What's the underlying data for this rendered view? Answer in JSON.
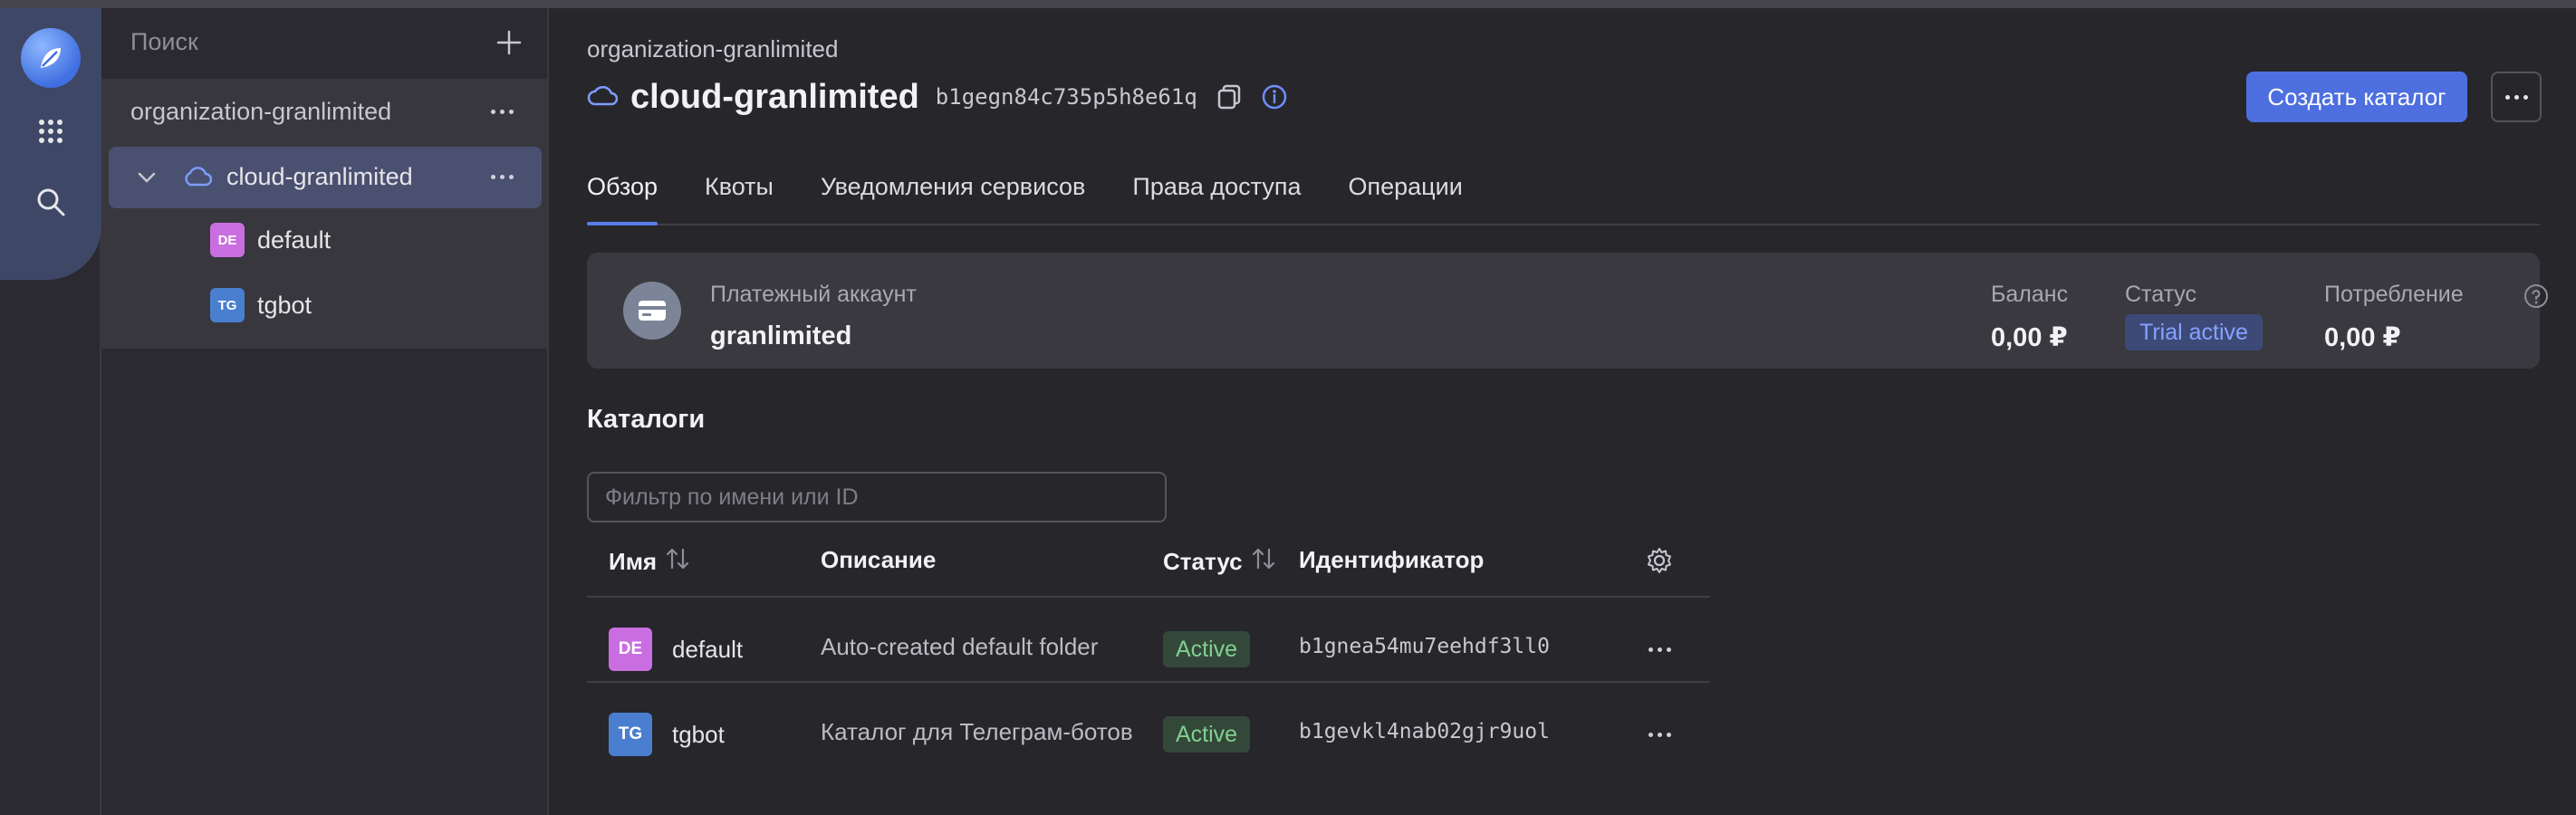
{
  "nav": {
    "logo": "yandex-cloud-logo",
    "icons": [
      "services-grid-icon",
      "search-icon"
    ]
  },
  "sidebar": {
    "search_placeholder": "Поиск",
    "organization": "organization-granlimited",
    "cloud": "cloud-granlimited",
    "folders": [
      {
        "badge": "DE",
        "name": "default",
        "color": "#c96ee0"
      },
      {
        "badge": "TG",
        "name": "tgbot",
        "color": "#4a7fd0"
      }
    ]
  },
  "header": {
    "breadcrumb": "organization-granlimited",
    "title": "cloud-granlimited",
    "cloud_id": "b1gegn84c735p5h8e61q",
    "create_button": "Создать каталог"
  },
  "tabs": [
    "Обзор",
    "Квоты",
    "Уведомления сервисов",
    "Права доступа",
    "Операции"
  ],
  "billing": {
    "account_label": "Платежный аккаунт",
    "account_name": "granlimited",
    "balance_label": "Баланс",
    "balance_value": "0,00 ₽",
    "status_label": "Статус",
    "status_value": "Trial active",
    "consumption_label": "Потребление",
    "consumption_value": "0,00 ₽"
  },
  "catalogs": {
    "title": "Каталоги",
    "filter_placeholder": "Фильтр по имени или ID",
    "columns": [
      "Имя",
      "Описание",
      "Статус",
      "Идентификатор"
    ],
    "rows": [
      {
        "badge": "DE",
        "name": "default",
        "description": "Auto-created default folder",
        "status": "Active",
        "id": "b1gnea54mu7eehdf3ll0"
      },
      {
        "badge": "TG",
        "name": "tgbot",
        "description": "Каталог для Телеграм-ботов",
        "status": "Active",
        "id": "b1gevkl4nab02gjr9uol"
      }
    ]
  },
  "colors": {
    "accent": "#4d6fe0",
    "active_green": "#7fd18f",
    "trial_blue": "#86a2ff"
  }
}
